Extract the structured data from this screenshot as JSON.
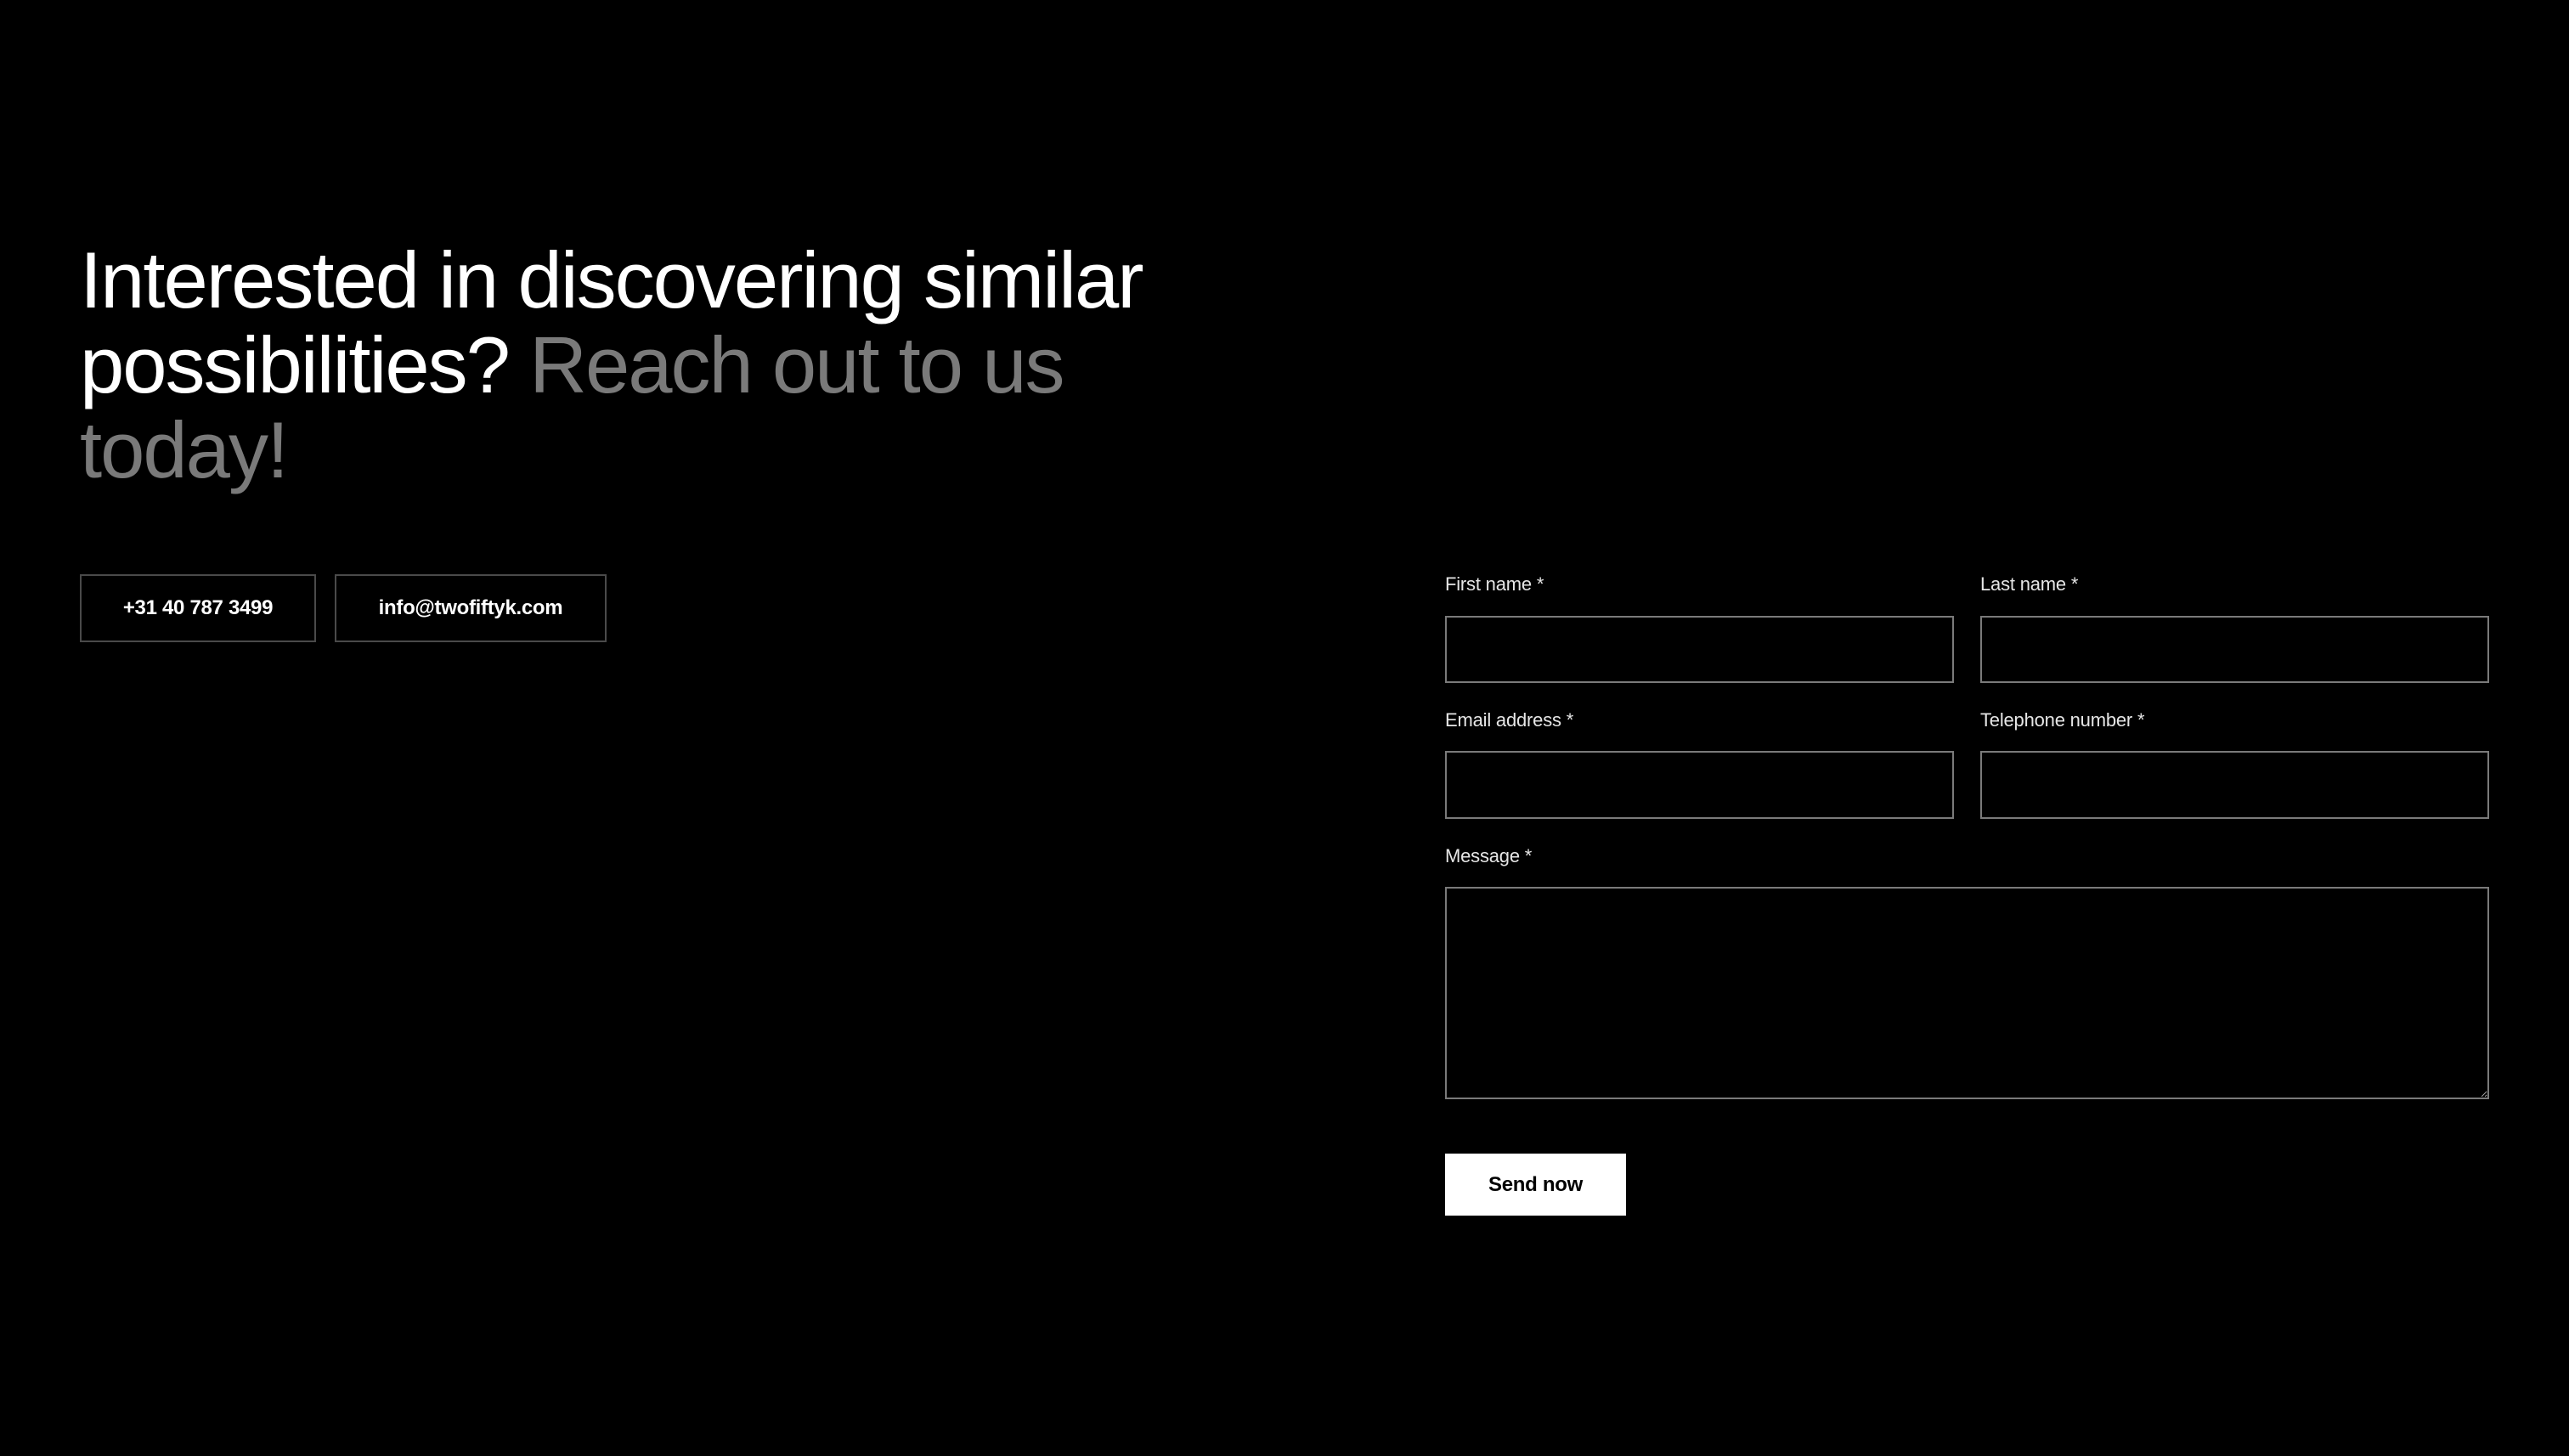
{
  "headline": {
    "primary": "Interested in discovering similar possibilities?",
    "secondary": "Reach out to us today!"
  },
  "contact": {
    "phone": "+31 40 787 3499",
    "email": "info@twofiftyk.com"
  },
  "form": {
    "first_name_label": "First name *",
    "first_name_value": "",
    "last_name_label": "Last name *",
    "last_name_value": "",
    "email_label": "Email address *",
    "email_value": "",
    "telephone_label": "Telephone number *",
    "telephone_value": "",
    "message_label": "Message *",
    "message_value": "",
    "submit_label": "Send now"
  },
  "colors": {
    "background": "#000000",
    "text": "#ffffff",
    "muted_text": "#7a7a7a",
    "field_border": "#7a7a7a",
    "button_background": "#ffffff",
    "button_text": "#000000"
  }
}
